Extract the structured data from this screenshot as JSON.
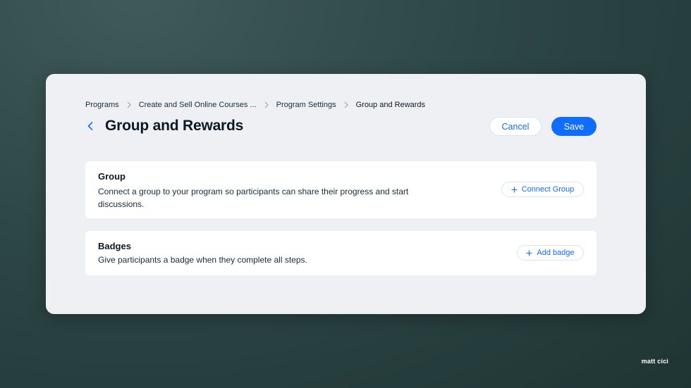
{
  "breadcrumb": {
    "items": [
      {
        "label": "Programs"
      },
      {
        "label": "Create and Sell Online Courses ..."
      },
      {
        "label": "Program Settings"
      },
      {
        "label": "Group and Rewards"
      }
    ]
  },
  "header": {
    "title": "Group and Rewards",
    "cancel_label": "Cancel",
    "save_label": "Save"
  },
  "sections": {
    "group": {
      "title": "Group",
      "description": "Connect a group to your program so participants can share their progress and start discussions.",
      "action_label": "Connect Group"
    },
    "badges": {
      "title": "Badges",
      "description": "Give participants a badge when they complete all steps.",
      "action_label": "Add badge"
    }
  },
  "watermark": "matt cici",
  "colors": {
    "accent": "#116dff",
    "panel_bg": "#eef0f3",
    "text_primary": "#0b1a26"
  },
  "icons": {
    "back": "chevron-left-icon",
    "separator": "chevron-right-icon",
    "add": "plus-icon"
  }
}
